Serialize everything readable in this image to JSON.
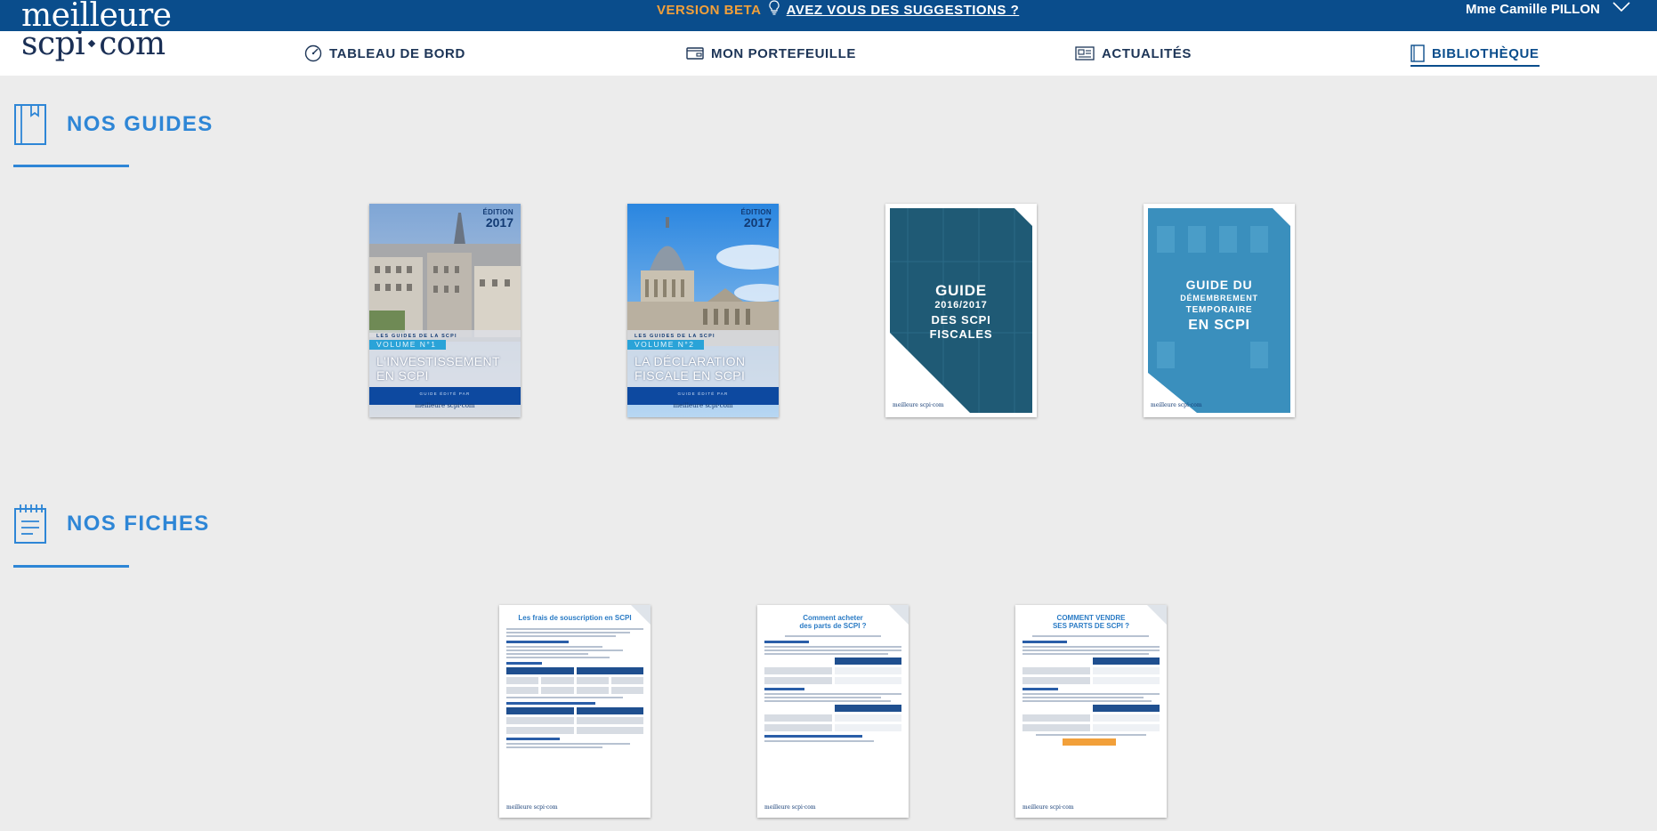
{
  "colors": {
    "topbar": "#0a4d8c",
    "accent_blue": "#2e86d6",
    "beta_orange": "#f2a03a",
    "nav_text": "#1d3557"
  },
  "logo": {
    "line1": "meilleure",
    "line2_a": "scpi",
    "line2_b": "com"
  },
  "topbar": {
    "beta_label": "VERSION BETA",
    "suggestions_link": "AVEZ VOUS DES SUGGESTIONS ?",
    "user_name": "Mme Camille PILLON"
  },
  "nav": {
    "items": [
      {
        "label": "TABLEAU DE BORD",
        "icon": "dashboard-gauge-icon"
      },
      {
        "label": "MON PORTEFEUILLE",
        "icon": "wallet-icon"
      },
      {
        "label": "ACTUALITÉS",
        "icon": "newspaper-icon"
      },
      {
        "label": "BIBLIOTHÈQUE",
        "icon": "book-icon",
        "active": true
      }
    ]
  },
  "sections": {
    "guides": {
      "title": "NOS GUIDES",
      "icon": "book-icon"
    },
    "fiches": {
      "title": "NOS FICHES",
      "icon": "notepad-icon"
    }
  },
  "guides": [
    {
      "edition_label": "ÉDITION",
      "edition_year": "2017",
      "series": "LES GUIDES DE LA SCPI",
      "volume": "VOLUME N°1",
      "title": "L'INVESTISSEMENT EN SCPI",
      "footer": "GUIDE ÉDITÉ PAR",
      "logo": "meilleure scpi·com"
    },
    {
      "edition_label": "ÉDITION",
      "edition_year": "2017",
      "series": "LES GUIDES DE LA SCPI",
      "volume": "VOLUME N°2",
      "title": "LA DÉCLARATION FISCALE EN SCPI",
      "footer": "GUIDE ÉDITÉ PAR",
      "logo": "meilleure scpi·com"
    },
    {
      "l1": "GUIDE",
      "l2": "2016/2017",
      "l3": "DES SCPI",
      "l4": "FISCALES",
      "logo": "meilleure scpi·com"
    },
    {
      "l1": "GUIDE DU",
      "l2": "DÉMEMBREMENT",
      "l3": "TEMPORAIRE",
      "l4": "EN SCPI",
      "logo": "meilleure scpi·com"
    }
  ],
  "fiches": [
    {
      "title_l1": "Les frais de souscription en SCPI",
      "title_l2": "",
      "logo": "meilleure scpi·com"
    },
    {
      "title_l1": "Comment acheter",
      "title_l2": "des parts de SCPI ?",
      "logo": "meilleure scpi·com"
    },
    {
      "title_l1": "COMMENT VENDRE",
      "title_l2": "SES PARTS DE SCPI ?",
      "logo": "meilleure scpi·com"
    }
  ]
}
